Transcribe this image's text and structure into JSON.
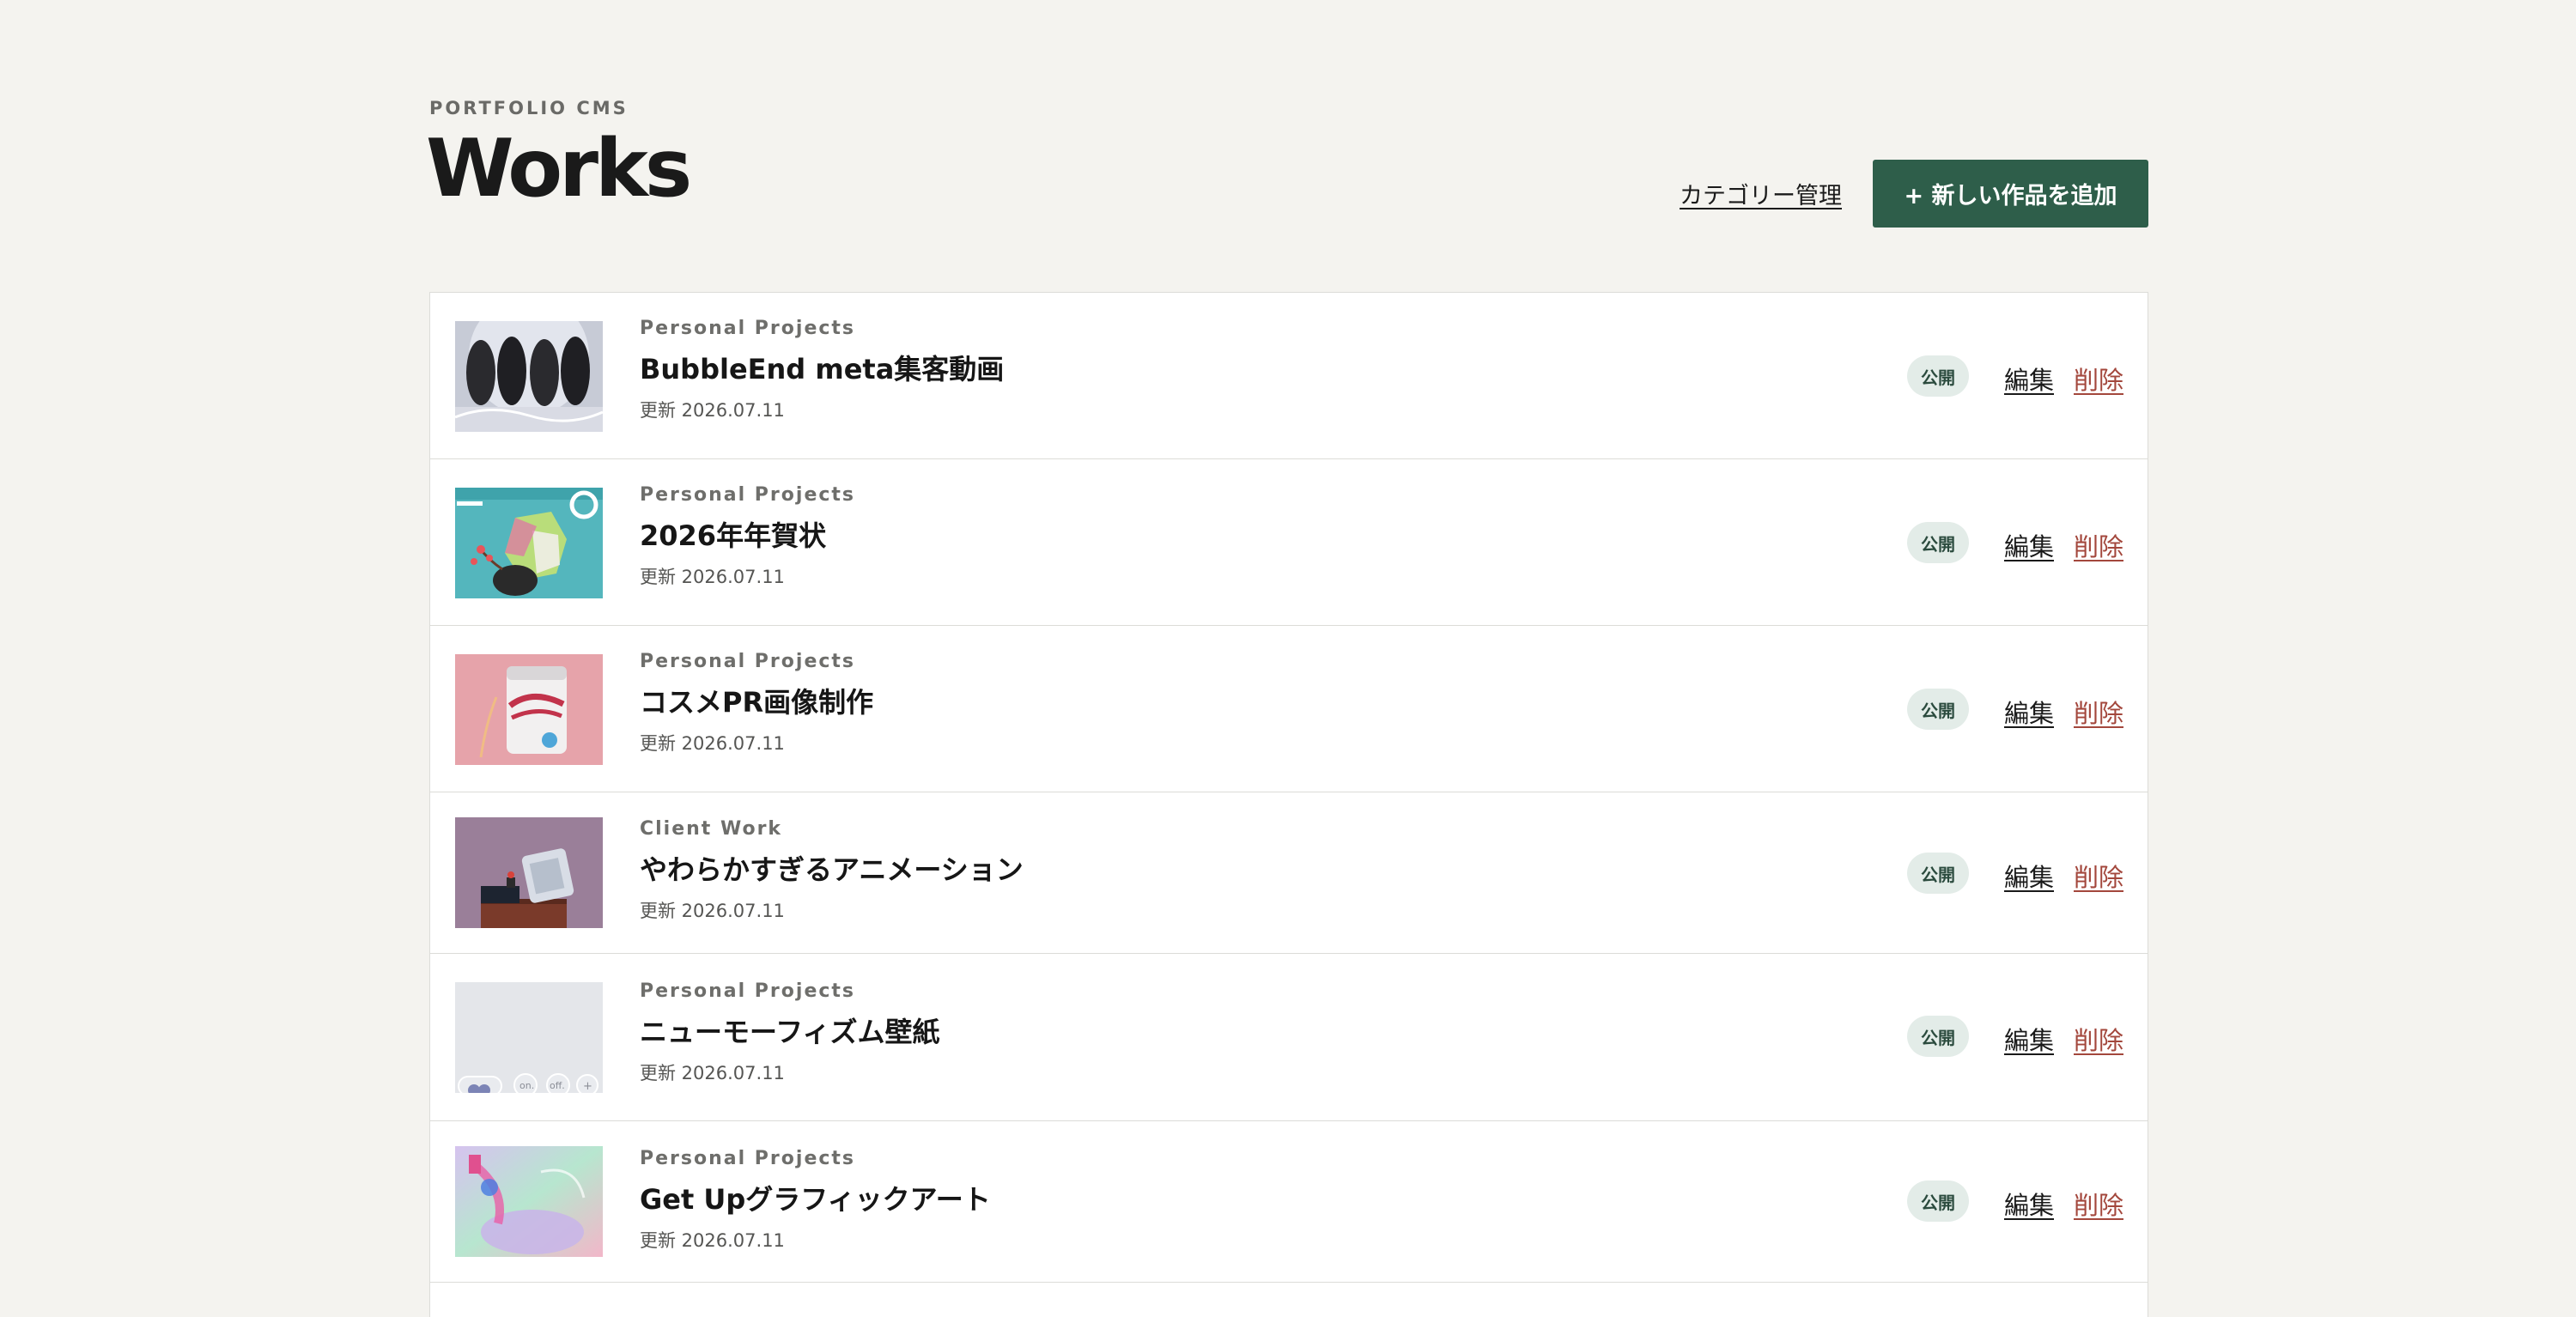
{
  "header": {
    "eyebrow": "PORTFOLIO CMS",
    "title": "Works",
    "category_link": "カテゴリー管理",
    "add_button": "+ 新しい作品を追加"
  },
  "works": [
    {
      "category": "Personal Projects",
      "title": "BubbleEnd meta集客動画",
      "updated": "更新 2026.07.11",
      "status": "公開",
      "edit": "編集",
      "delete": "削除",
      "thumbnail": "four-figures-bubble-thumbnail"
    },
    {
      "category": "Personal Projects",
      "title": "2026年年賀状",
      "updated": "更新 2026.07.11",
      "status": "公開",
      "edit": "編集",
      "delete": "削除",
      "thumbnail": "new-year-card-thumbnail"
    },
    {
      "category": "Personal Projects",
      "title": "コスメPR画像制作",
      "updated": "更新 2026.07.11",
      "status": "公開",
      "edit": "編集",
      "delete": "削除",
      "thumbnail": "cosmetic-package-thumbnail"
    },
    {
      "category": "Client Work",
      "title": "やわらかすぎるアニメーション",
      "updated": "更新 2026.07.11",
      "status": "公開",
      "edit": "編集",
      "delete": "削除",
      "thumbnail": "soft-animation-thumbnail"
    },
    {
      "category": "Personal Projects",
      "title": "ニューモーフィズム壁紙",
      "updated": "更新 2026.07.11",
      "status": "公開",
      "edit": "編集",
      "delete": "削除",
      "thumbnail": "neumorphism-wallpaper-thumbnail",
      "thumbnail_labels": [
        "on.",
        "off."
      ]
    },
    {
      "category": "Personal Projects",
      "title": "Get Upグラフィックアート",
      "updated": "更新 2026.07.11",
      "status": "公開",
      "edit": "編集",
      "delete": "削除",
      "thumbnail": "graphic-art-thumbnail"
    }
  ],
  "colors": {
    "background": "#f4f3ef",
    "accent": "#2e5e4a",
    "delete": "#a3473c",
    "badge_bg": "#e3ece8"
  }
}
